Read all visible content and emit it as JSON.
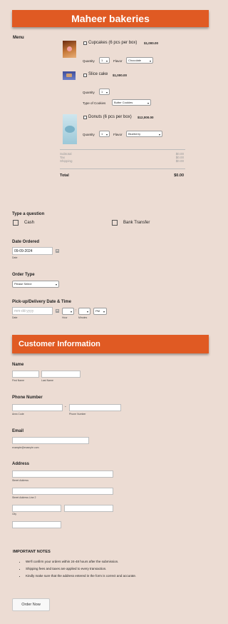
{
  "title": "Maheer bakeries",
  "menu_label": "Menu",
  "products": [
    {
      "name": "Cupcakes (6 pcs per box)",
      "price": "$1,000.00",
      "qty_label": "Quantity",
      "qty": "1",
      "opt_label": "Flavor",
      "opt_value": "Chocolate"
    },
    {
      "name": "Slice cake",
      "price": "$1,000.00",
      "qty_label": "Quantity",
      "qty": "1",
      "opt_label": "Type of Cookies",
      "opt_value": "Butter Cookies"
    },
    {
      "name": "Donuts (6 pcs per box)",
      "price": "$12,000.00",
      "qty_label": "Quantity",
      "qty": "1",
      "opt_label": "Flavor",
      "opt_value": "Blueberry"
    }
  ],
  "summary": {
    "subtotal_label": "Subtotal",
    "subtotal": "$0.00",
    "tax_label": "Tax",
    "tax": "$0.00",
    "shipping_label": "Shipping",
    "shipping": "$0.00",
    "total_label": "Total",
    "total": "$0.00"
  },
  "question": {
    "label": "Type a question",
    "opt1": "Cash",
    "opt2": "Bank Transfer"
  },
  "date_ordered": {
    "label": "Date Ordered",
    "value": "09-09-2024",
    "sub": "Date"
  },
  "order_type": {
    "label": "Order Type",
    "value": "Please Select"
  },
  "pickup": {
    "label": "Pick-up/Delivery Date & Time",
    "placeholder": "mm-dd-yyyy",
    "date_sub": "Date",
    "hour_sub": "Hour",
    "min_sub": "Minutes",
    "ampm": "PM",
    "colon": ":"
  },
  "customer_title": "Customer Information",
  "name": {
    "label": "Name",
    "first": "First Name",
    "last": "Last Name"
  },
  "phone": {
    "label": "Phone Number",
    "area": "Area Code",
    "number": "Phone Number",
    "dash": "-"
  },
  "email": {
    "label": "Email",
    "sub": "example@example.com"
  },
  "address": {
    "label": "Address",
    "street": "Street Address",
    "street2": "Street Address Line 2",
    "city": "City"
  },
  "notes": {
    "title": "IMPORTANT NOTES",
    "items": [
      "We'll confirm your orders within 24-48 hours after the submission.",
      "Shipping fees and taxes are applied to every transaction.",
      "Kindly make sure that the address entered in the form is correct and accurate."
    ]
  },
  "submit_label": "Order Now",
  "colors": {
    "accent": "#e05a23",
    "background": "#ecdcd3"
  }
}
